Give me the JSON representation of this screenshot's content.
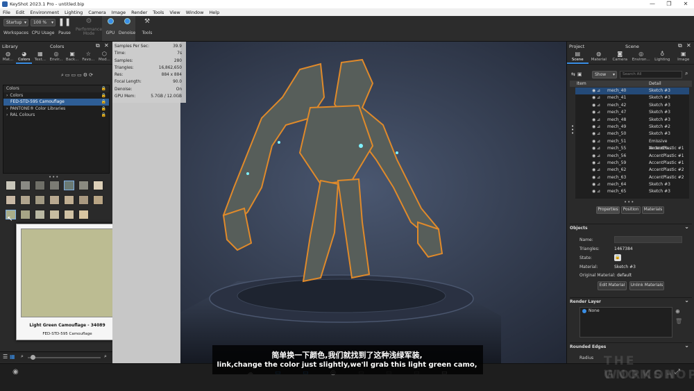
{
  "window": {
    "title": "KeyShot 2023.1 Pro  -  untitled.bip",
    "controls": [
      "—",
      "❐",
      "✕"
    ]
  },
  "menu": [
    "File",
    "Edit",
    "Environment",
    "Lighting",
    "Camera",
    "Image",
    "Render",
    "Tools",
    "View",
    "Window",
    "Help"
  ],
  "toolbar": {
    "workspace_value": "Startup",
    "zoom_value": "100 %",
    "workspaces_label": "Workspaces",
    "cpu_usage_label": "CPU Usage",
    "pause_label": "Pause",
    "performance_mode_label": "Performance Mode",
    "gpu_label": "GPU",
    "denoise_label": "Denoise",
    "tools_label": "Tools"
  },
  "library": {
    "title": "Library",
    "sub_title": "Colors",
    "tabs": [
      {
        "label": "Mat...",
        "icon": "material-icon"
      },
      {
        "label": "Colors",
        "icon": "colors-icon",
        "active": true
      },
      {
        "label": "Text...",
        "icon": "texture-icon"
      },
      {
        "label": "Envir...",
        "icon": "environment-icon"
      },
      {
        "label": "Back...",
        "icon": "backplate-icon"
      },
      {
        "label": "Favo...",
        "icon": "favorites-icon"
      },
      {
        "label": "Mod...",
        "icon": "models-icon"
      }
    ],
    "tree": [
      {
        "label": "Colors",
        "indent": 0
      },
      {
        "label": "Colors",
        "indent": 0,
        "arrow": "›"
      },
      {
        "label": "FED-STD-595 Camouflage",
        "indent": 1,
        "selected": true
      },
      {
        "label": "PANTONE® Color Libraries",
        "indent": 0,
        "arrow": "›"
      },
      {
        "label": "RAL Colours",
        "indent": 0,
        "arrow": "›"
      }
    ],
    "swatches": [
      "#c9c6ba",
      "#8a8a84",
      "#6f6f68",
      "#7c7c74",
      "#6a7a74",
      "#8a8a80",
      "#ddd0b8",
      "#c8b8a4",
      "#b0a48e",
      "#a09882",
      "#b8a890",
      "#c0ae92",
      "#a89880",
      "#b8a484",
      "#a9ad8a",
      "#a6a586",
      "#b9b8a3",
      "#c6bca0",
      "#d0c2a4",
      "#d8c6a2"
    ],
    "popup": {
      "color": "#bcbc92",
      "name": "Light Green Camouflage - 34089",
      "library": "FED-STD-595 Camouflage"
    }
  },
  "stats": [
    {
      "label": "Samples Per Sec:",
      "value": "39.9"
    },
    {
      "label": "Time:",
      "value": "7s"
    },
    {
      "label": "Samples:",
      "value": "280"
    },
    {
      "label": "Triangles:",
      "value": "16,862,650"
    },
    {
      "label": "Res:",
      "value": "884 x 884"
    },
    {
      "label": "Focal Length:",
      "value": "90.0"
    },
    {
      "label": "Denoise:",
      "value": "On"
    },
    {
      "label": "GPU Mem:",
      "value": "5.7GB / 12.0GB"
    }
  ],
  "project": {
    "title": "Project",
    "sub_title": "Scene",
    "tabs": [
      {
        "label": "Scene",
        "active": true
      },
      {
        "label": "Material"
      },
      {
        "label": "Camera"
      },
      {
        "label": "Environ..."
      },
      {
        "label": "Lighting"
      },
      {
        "label": "Image"
      }
    ],
    "show_value": "Show",
    "search_placeholder": "Search All",
    "col_item": "Item",
    "col_detail": "Detail",
    "rows": [
      {
        "name": "mech_40",
        "detail": "Sketch #3",
        "selected": true
      },
      {
        "name": "mech_41",
        "detail": "Sketch #3"
      },
      {
        "name": "mech_42",
        "detail": "Sketch #3"
      },
      {
        "name": "mech_47",
        "detail": "Sketch #3"
      },
      {
        "name": "mech_48",
        "detail": "Sketch #3"
      },
      {
        "name": "mech_49",
        "detail": "Sketch #2"
      },
      {
        "name": "mech_50",
        "detail": "Sketch #3"
      },
      {
        "name": "mech_51",
        "detail": "Emissive VertexCo..."
      },
      {
        "name": "mech_55",
        "detail": "AccentPlastic #1"
      },
      {
        "name": "mech_56",
        "detail": "AccentPlastic #1"
      },
      {
        "name": "mech_59",
        "detail": "AccentPlastic #1"
      },
      {
        "name": "mech_62",
        "detail": "AccentPlastic #2"
      },
      {
        "name": "mech_63",
        "detail": "AccentPlastic #2"
      },
      {
        "name": "mech_64",
        "detail": "Sketch #3"
      },
      {
        "name": "mech_65",
        "detail": "Sketch #3"
      }
    ],
    "subtabs": [
      "Properties",
      "Position",
      "Materials"
    ],
    "objects_title": "Objects",
    "props": [
      {
        "label": "Name:",
        "value": ""
      },
      {
        "label": "Triangles:",
        "value": "1467384"
      },
      {
        "label": "State:",
        "value": ""
      },
      {
        "label": "Material:",
        "value": "Sketch #3"
      },
      {
        "label": "Original Material:",
        "value": "default"
      }
    ],
    "edit_material": "Edit Material",
    "unlink_materials": "Unlink Materials",
    "render_layer_title": "Render Layer",
    "render_layer_item": "None",
    "rounded_edges_title": "Rounded Edges",
    "radius_label": "Radius"
  },
  "subtitles": {
    "zh": "简单换一下颜色,我们就找到了这种浅绿军装,",
    "en": "link,change the color just slightly,we'll grab this light green camo,"
  },
  "watermark": {
    "line1": "THE GNOMON",
    "line2": "WORKSHOP"
  }
}
